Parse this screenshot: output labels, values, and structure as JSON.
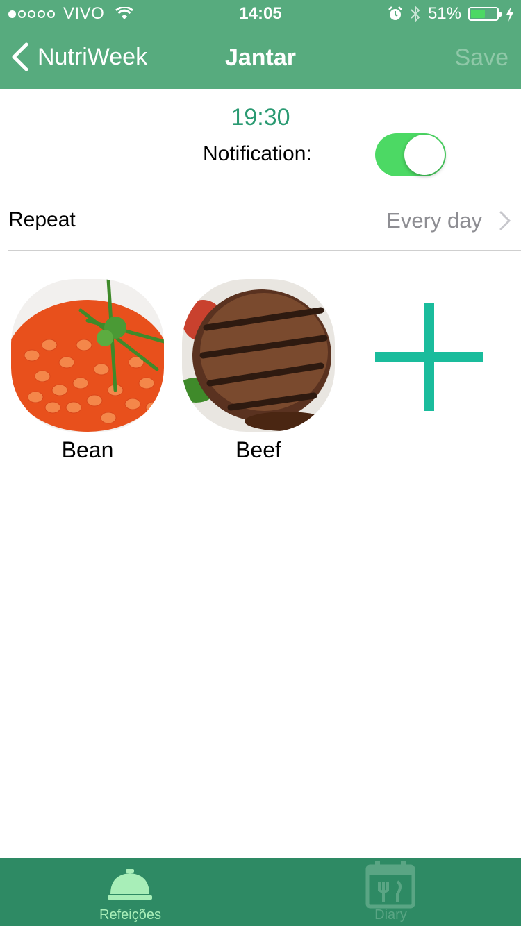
{
  "status_bar": {
    "carrier": "VIVO",
    "time": "14:05",
    "battery": "51%"
  },
  "nav": {
    "back_label": "NutriWeek",
    "title": "Jantar",
    "save_label": "Save"
  },
  "meal": {
    "time": "19:30",
    "notification_label": "Notification:",
    "notification_on": true,
    "repeat_label": "Repeat",
    "repeat_value": "Every day"
  },
  "foods": [
    {
      "name": "Bean",
      "icon": "baked-beans-photo"
    },
    {
      "name": "Beef",
      "icon": "grilled-steak-photo"
    }
  ],
  "tabs": [
    {
      "label": "Refeições",
      "icon": "service-bell-icon",
      "active": true
    },
    {
      "label": "Diary",
      "icon": "calendar-fork-knife-icon",
      "active": false
    }
  ],
  "colors": {
    "header": "#57ab7e",
    "accent": "#2a9a72",
    "toggle_on": "#4cd964",
    "tab_bar": "#2e8a64",
    "add_icon": "#1abc9c"
  }
}
